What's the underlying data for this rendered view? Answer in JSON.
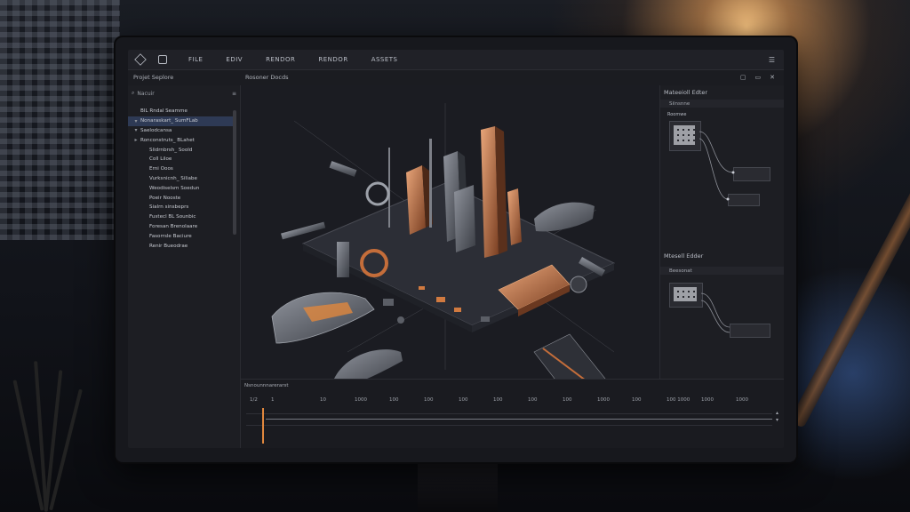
{
  "menu": {
    "items": [
      "FILE",
      "EDIV",
      "RENDOR",
      "RENDOR",
      "ASSETS"
    ],
    "right_icons": [
      "window-icon",
      "close-icon",
      "hamburger-icon"
    ]
  },
  "left_panel": {
    "title": "Projet Seplore",
    "search_label": "Nacuir",
    "tree": [
      {
        "caret": "",
        "label": "BIL Rndal Seamme",
        "selected": false
      },
      {
        "caret": "▾",
        "label": "Nonaraskart_ SumFLab",
        "selected": true
      },
      {
        "caret": "▾",
        "label": "Saelodcansa",
        "selected": false
      },
      {
        "caret": "▸",
        "label": "Ronconstruts_ BLahet",
        "selected": false
      },
      {
        "caret": "",
        "label": "Slidrnbrsh_ Soold",
        "selected": false
      },
      {
        "caret": "",
        "label": "Coll Liloe",
        "selected": false
      },
      {
        "caret": "",
        "label": "Erni Ooos",
        "selected": false
      },
      {
        "caret": "",
        "label": "Vurksnicnh_ Siliabe",
        "selected": false
      },
      {
        "caret": "",
        "label": "Weodiselsm Soedun",
        "selected": false
      },
      {
        "caret": "",
        "label": "Poeir Nooste",
        "selected": false
      },
      {
        "caret": "",
        "label": "Sialrn sinsbeprs",
        "selected": false
      },
      {
        "caret": "",
        "label": "Fustecl BL Sounbic",
        "selected": false
      },
      {
        "caret": "",
        "label": "Foresan Brenolaare",
        "selected": false
      },
      {
        "caret": "",
        "label": "Fasorrsle Baciure",
        "selected": false
      },
      {
        "caret": "",
        "label": "Renir Bueodrae",
        "selected": false
      }
    ]
  },
  "viewport": {
    "title": "Rosoner Docds"
  },
  "right_panel": {
    "editor1_title": "Mateeioll Edter",
    "editor1_bar": "Siinsnne",
    "editor1_sub": "Roomwe",
    "editor2_title": "Mtesell Edder",
    "editor2_bar": "Beesonat"
  },
  "timeline": {
    "title": "Nsnounnnarerarst",
    "ticks": [
      "1/2",
      "1",
      "10",
      "1000",
      "100",
      "100",
      "100",
      "100",
      "100",
      "100",
      "1000",
      "100",
      "100 1000",
      "1000",
      "1000"
    ]
  },
  "colors": {
    "accent": "#e0873d",
    "selection": "#2e3a55"
  }
}
